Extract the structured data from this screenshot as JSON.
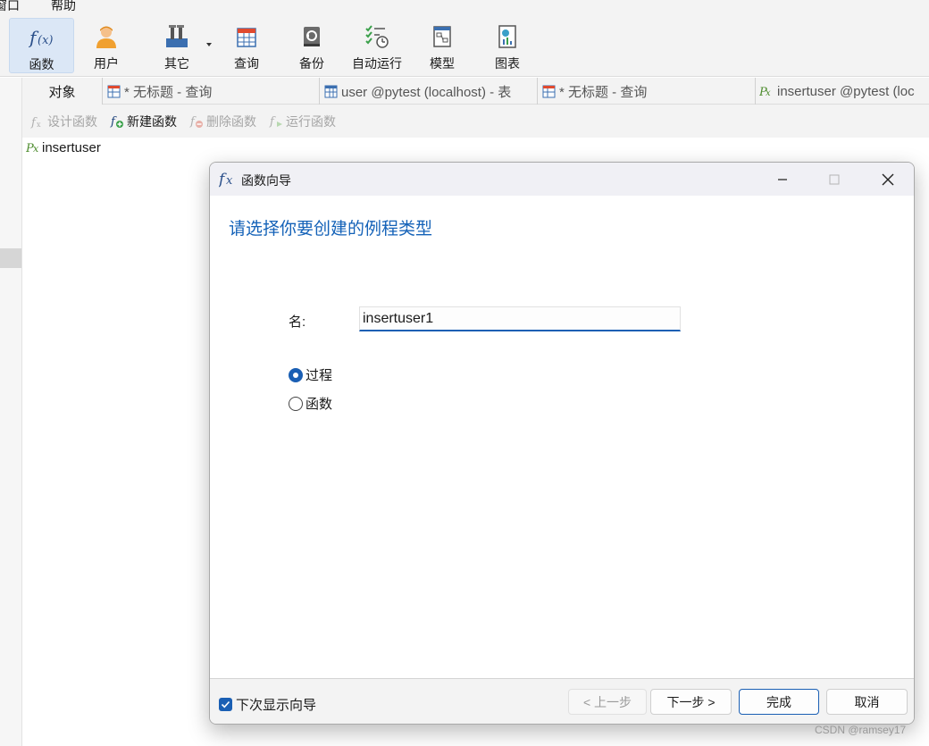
{
  "menubar": {
    "items": [
      "窗口",
      "帮助"
    ]
  },
  "toolbar": {
    "buttons": [
      {
        "label": "函数",
        "icon": "function-icon",
        "active": true
      },
      {
        "label": "用户",
        "icon": "user-icon"
      },
      {
        "label": "其它",
        "icon": "tools-icon"
      },
      {
        "label": "查询",
        "icon": "query-icon"
      },
      {
        "label": "备份",
        "icon": "backup-icon"
      },
      {
        "label": "自动运行",
        "icon": "automation-icon"
      },
      {
        "label": "模型",
        "icon": "model-icon"
      },
      {
        "label": "图表",
        "icon": "chart-icon"
      }
    ]
  },
  "tabs": [
    {
      "label": "对象"
    },
    {
      "label": "* 无标题 - 查询",
      "icon": "query-tab-icon"
    },
    {
      "label": "user @pytest (localhost) - 表",
      "icon": "table-tab-icon"
    },
    {
      "label": "* 无标题 - 查询",
      "icon": "query-tab-icon"
    },
    {
      "label": "insertuser @pytest (loc",
      "icon": "procedure-tab-icon"
    }
  ],
  "objbar": {
    "design": "设计函数",
    "new": "新建函数",
    "delete": "删除函数",
    "run": "运行函数"
  },
  "objects": [
    {
      "name": "insertuser",
      "icon": "procedure-icon"
    }
  ],
  "dialog": {
    "title": "函数向导",
    "heading": "请选择你要创建的例程类型",
    "name_label": "名:",
    "name_value": "insertuser1",
    "options": [
      {
        "label": "过程",
        "selected": true
      },
      {
        "label": "函数",
        "selected": false
      }
    ],
    "show_wizard_label": "下次显示向导",
    "show_wizard_checked": true,
    "buttons": {
      "prev": "< 上一步",
      "next": "下一步 >",
      "finish": "完成",
      "cancel": "取消"
    }
  },
  "watermark": "CSDN @ramsey17",
  "colors": {
    "accent": "#1a5fb4",
    "heading": "#1462b8",
    "active_tool": "#dbe7f6"
  }
}
